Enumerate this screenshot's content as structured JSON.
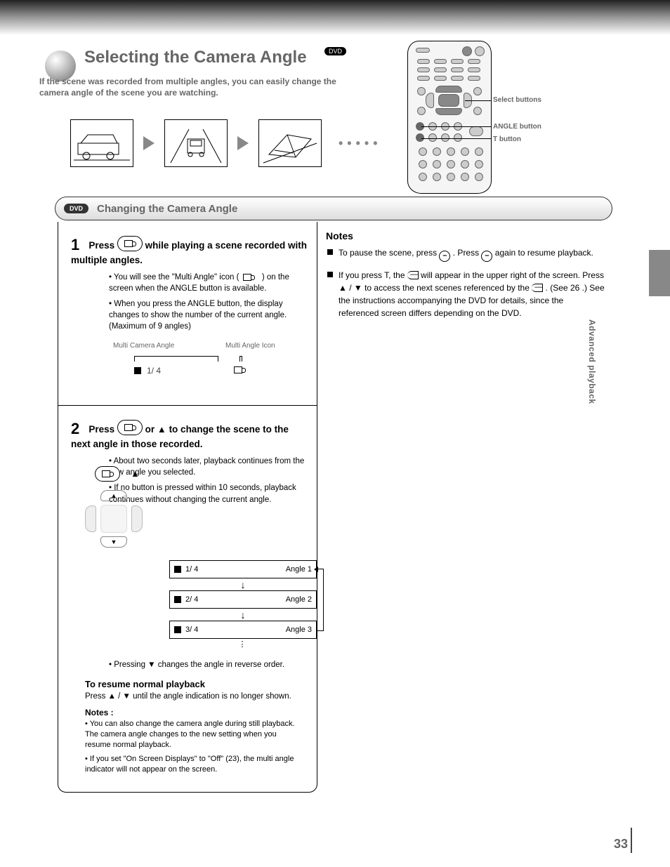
{
  "header": {
    "title": "Selecting the Camera Angle",
    "indicator": "DVD",
    "description": "If the scene was recorded from multiple angles, you can easily change the camera angle of the scene you are watching."
  },
  "remote_labels": {
    "top": "Select buttons",
    "mid": "ANGLE button",
    "bot": "T button"
  },
  "bar": {
    "tag": "DVD",
    "title": "Changing the Camera Angle"
  },
  "step1": {
    "num": "1",
    "heading_a": "Press ",
    "heading_b": " while playing a scene recorded with multiple angles.",
    "sub1": "• You will see the \"Multi Angle\" icon (",
    "sub1b": ") on the screen when the ANGLE button is available.",
    "sub2": "• When you press the ANGLE button, the display changes to show the number of the current angle. (Maximum of 9 angles)",
    "osd": {
      "label_left": "Multi Camera Angle",
      "label_right": "Multi Angle Icon",
      "center_text": "1/ 4"
    }
  },
  "step2": {
    "num": "2",
    "heading_a": "Press ",
    "heading_b": " or ",
    "heading_c": " to change the scene to the next angle in those recorded.",
    "sub1": "• About two seconds later, playback continues from the new angle you selected.",
    "sub2": "• If no button is pressed within 10 seconds, playback continues without changing the current angle.",
    "flow": {
      "box1": "Angle 1",
      "box2": "Angle 2",
      "box3": "Angle 3",
      "center": "1/ 4",
      "center2": "2/ 4",
      "center3": "3/ 4"
    },
    "resume_heading": "To resume normal playback",
    "resume_body_a": "Press ",
    "resume_body_b": " until the angle indication is no longer shown.",
    "notes_label": "Notes :",
    "note_ex": "• You can also change the camera angle during still playback. The camera angle changes to the new setting when you resume normal playback.",
    "note_ex2": "• If you set \"On Screen Displays\" to \"Off\", ( / ) will not appear on the screen.",
    "page_ref": "23"
  },
  "notes": {
    "heading": "Notes",
    "item1_a": "To pause the scene, press ",
    "item1_b": ". Press ",
    "item1_c": " again to resume playback.",
    "item2_a": "If you press T, the ",
    "item2_b": " will appear in the upper right of the screen. Press ",
    "item2_c": " to access the next scenes referenced by the ",
    "item2_d": ". (See ",
    "item2_e": ".) See the instructions accompanying the DVD for details, since the referenced screen differs depending on the DVD."
  },
  "side": {
    "label": "Advanced playback"
  },
  "page_number": "33"
}
